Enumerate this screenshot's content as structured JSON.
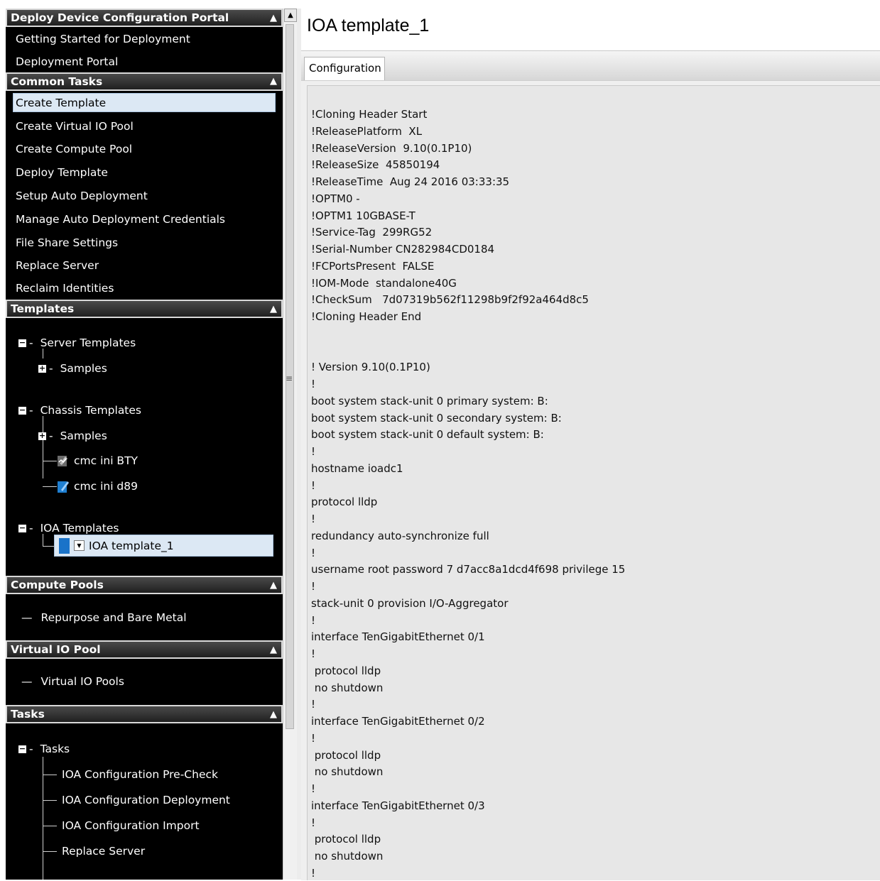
{
  "sidebar": {
    "sections": {
      "deploy": {
        "title": "Deploy Device Configuration Portal",
        "items": [
          "Getting Started for Deployment",
          "Deployment Portal"
        ]
      },
      "common": {
        "title": "Common Tasks",
        "items": [
          "Create Template",
          "Create Virtual IO Pool",
          "Create Compute Pool",
          "Deploy Template",
          "Setup Auto Deployment",
          "Manage Auto Deployment Credentials",
          "File Share Settings",
          "Replace Server",
          "Reclaim Identities"
        ],
        "selected": "Create Template"
      },
      "templates": {
        "title": "Templates",
        "server_templates": "Server Templates",
        "server_samples": "Samples",
        "chassis_templates": "Chassis Templates",
        "chassis_samples": "Samples",
        "chassis_item_1": "cmc ini BTY",
        "chassis_item_2": "cmc ini d89",
        "ioa_templates": "IOA Templates",
        "ioa_item": "IOA template_1"
      },
      "compute": {
        "title": "Compute Pools",
        "item": "Repurpose and Bare Metal"
      },
      "virtual": {
        "title": "Virtual IO Pool",
        "item": "Virtual IO Pools"
      },
      "tasks": {
        "title": "Tasks",
        "root": "Tasks",
        "items": [
          "IOA Configuration Pre-Check",
          "IOA Configuration Deployment",
          "IOA Configuration Import",
          "Replace Server"
        ]
      }
    }
  },
  "main": {
    "title": "IOA template_1",
    "tab": "Configuration",
    "config_lines": [
      "!Cloning Header Start",
      "!ReleasePlatform  XL",
      "!ReleaseVersion  9.10(0.1P10)",
      "!ReleaseSize  45850194",
      "!ReleaseTime  Aug 24 2016 03:33:35",
      "!OPTM0 -",
      "!OPTM1 10GBASE-T",
      "!Service-Tag  299RG52",
      "!Serial-Number CN282984CD0184",
      "!FCPortsPresent  FALSE",
      "!IOM-Mode  standalone40G",
      "!CheckSum   7d07319b562f11298b9f2f92a464d8c5",
      "!Cloning Header End",
      "",
      "",
      "! Version 9.10(0.1P10)",
      "!",
      "boot system stack-unit 0 primary system: B:",
      "boot system stack-unit 0 secondary system: B:",
      "boot system stack-unit 0 default system: B:",
      "!",
      "hostname ioadc1",
      "!",
      "protocol lldp",
      "!",
      "redundancy auto-synchronize full",
      "!",
      "username root password 7 d7acc8a1dcd4f698 privilege 15",
      "!",
      "stack-unit 0 provision I/O-Aggregator",
      "!",
      "interface TenGigabitEthernet 0/1",
      "!",
      " protocol lldp",
      " no shutdown",
      "!",
      "interface TenGigabitEthernet 0/2",
      "!",
      " protocol lldp",
      " no shutdown",
      "!",
      "interface TenGigabitEthernet 0/3",
      "!",
      " protocol lldp",
      " no shutdown",
      "!"
    ]
  },
  "icons": {
    "collapse": "chevron-up-icon",
    "expand_tree": "plus-box-icon",
    "collapse_tree": "minus-box-icon",
    "scroll_up": "arrow-up-icon",
    "splitter": "grip-icon"
  },
  "colors": {
    "nav_bg": "#000000",
    "header_border": "#d9d9d9",
    "selection": "#dce8f4",
    "config_bg": "#e7e7e7"
  }
}
